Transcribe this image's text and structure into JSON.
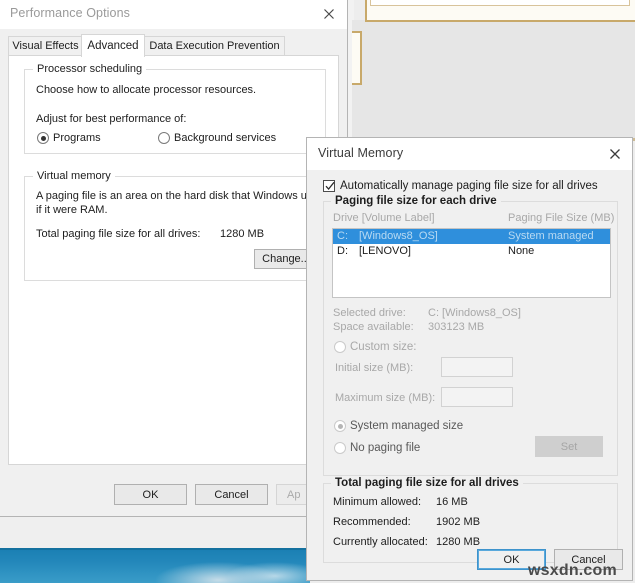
{
  "desktop": {
    "watermark": "wsxdn.com"
  },
  "performance_options": {
    "title": "Performance Options",
    "close_icon": "close-icon",
    "tabs": [
      {
        "label": "Visual Effects",
        "active": false
      },
      {
        "label": "Advanced",
        "active": true
      },
      {
        "label": "Data Execution Prevention",
        "active": false
      }
    ],
    "processor_scheduling": {
      "legend": "Processor scheduling",
      "description": "Choose how to allocate processor resources.",
      "adjust_label": "Adjust for best performance of:",
      "options": [
        {
          "label": "Programs",
          "selected": true
        },
        {
          "label": "Background services",
          "selected": false
        }
      ]
    },
    "virtual_memory": {
      "legend": "Virtual memory",
      "description_line1": "A paging file is an area on the hard disk that Windows uses",
      "description_line2": "if it were RAM.",
      "total_label": "Total paging file size for all drives:",
      "total_value": "1280 MB",
      "change_button": "Change..."
    },
    "buttons": {
      "ok": "OK",
      "cancel": "Cancel",
      "apply": "Ap"
    }
  },
  "virtual_memory_dialog": {
    "title": "Virtual Memory",
    "close_icon": "close-icon",
    "auto_manage": {
      "label": "Automatically manage paging file size for all drives",
      "checked": true
    },
    "paging_group": {
      "legend": "Paging file size for each drive",
      "columns": [
        "Drive  [Volume Label]",
        "Paging File Size (MB)"
      ],
      "rows": [
        {
          "drive": "C:",
          "volume": "[Windows8_OS]",
          "size": "System managed",
          "selected": true
        },
        {
          "drive": "D:",
          "volume": "[LENOVO]",
          "size": "None",
          "selected": false
        }
      ],
      "selected_drive_label": "Selected drive:",
      "selected_drive_value": "C:  [Windows8_OS]",
      "space_available_label": "Space available:",
      "space_available_value": "303123 MB",
      "custom_size": {
        "label": "Custom size:",
        "selected": false
      },
      "initial_size_label": "Initial size (MB):",
      "initial_size_value": "",
      "maximum_size_label": "Maximum size (MB):",
      "maximum_size_value": "",
      "system_managed": {
        "label": "System managed size",
        "selected": true
      },
      "no_paging_file": {
        "label": "No paging file",
        "selected": false
      },
      "set_button": "Set"
    },
    "totals_group": {
      "legend": "Total paging file size for all drives",
      "rows": [
        {
          "label": "Minimum allowed:",
          "value": "16 MB"
        },
        {
          "label": "Recommended:",
          "value": "1902 MB"
        },
        {
          "label": "Currently allocated:",
          "value": "1280 MB"
        }
      ]
    },
    "buttons": {
      "ok": "OK",
      "cancel": "Cancel"
    }
  },
  "colors": {
    "selection_blue": "#2f8fdc",
    "focus_blue": "#3e93cc",
    "dialog_face": "#f0f0f0",
    "wallpaper_blue": "#2387ba",
    "bg_window_border": "#c8a96a"
  }
}
